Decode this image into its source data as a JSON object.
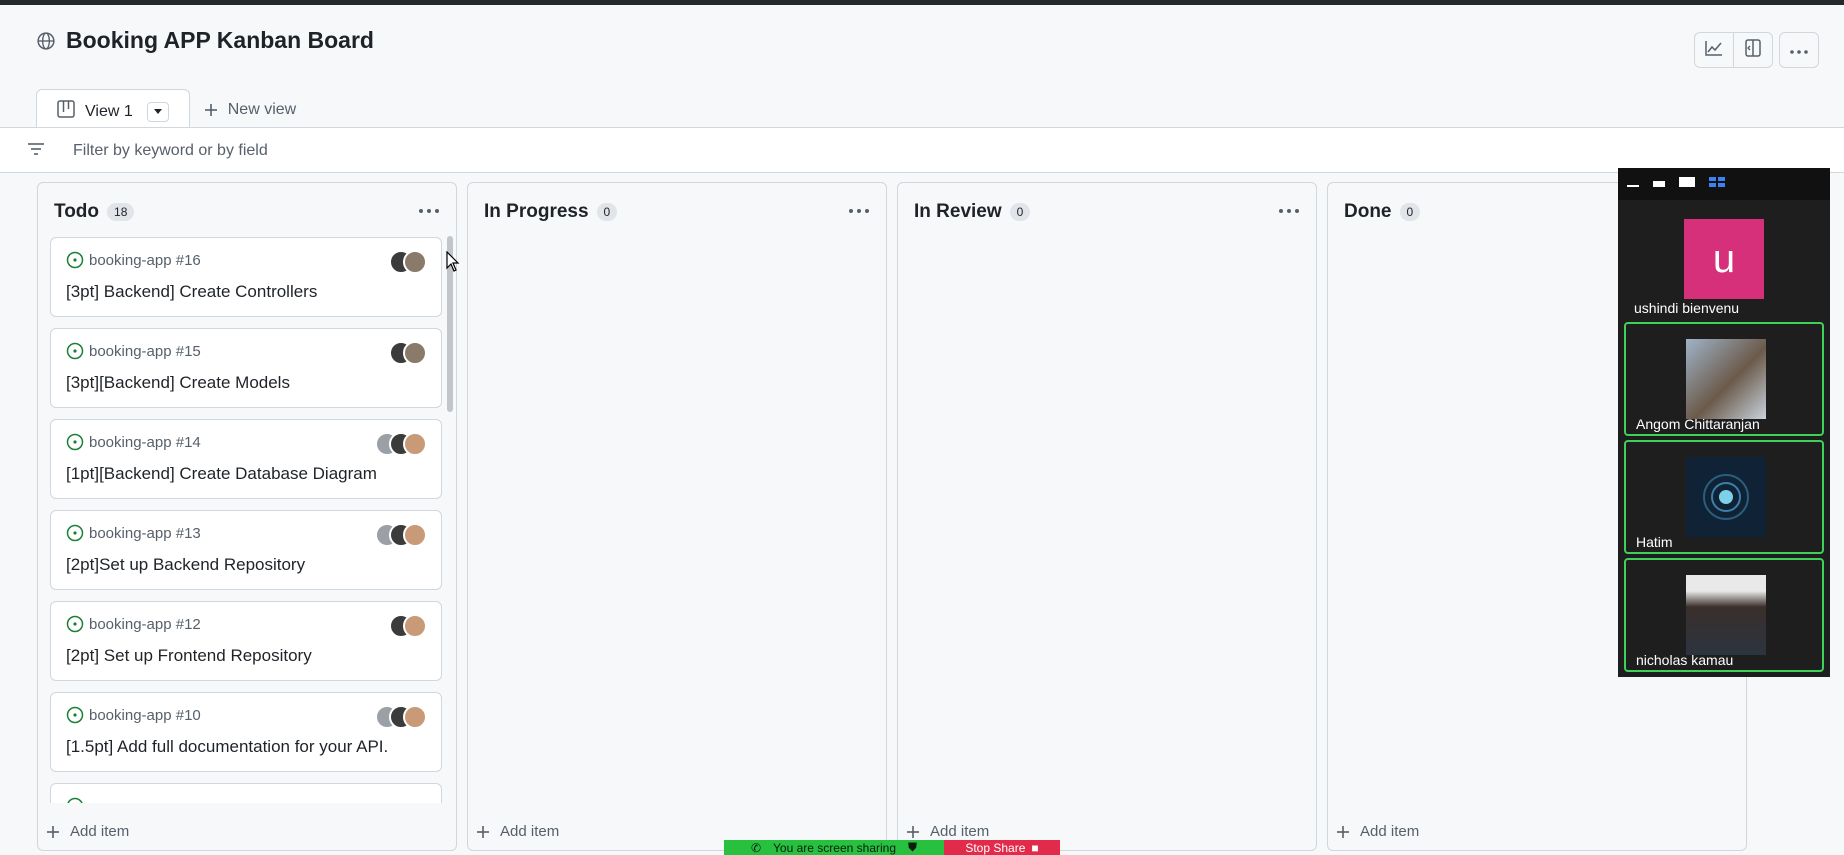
{
  "header": {
    "title": "Booking APP Kanban Board",
    "actions": [
      "insights-icon",
      "panel-icon",
      "more-icon"
    ]
  },
  "tabs": {
    "active_label": "View 1",
    "new_view_label": "New view"
  },
  "filter": {
    "placeholder": "Filter by keyword or by field"
  },
  "columns": [
    {
      "title": "Todo",
      "count": "18",
      "add_label": "Add item",
      "cards": [
        {
          "ref": "booking-app #16",
          "title": "[3pt] Backend] Create Controllers"
        },
        {
          "ref": "booking-app #15",
          "title": "[3pt][Backend] Create Models"
        },
        {
          "ref": "booking-app #14",
          "title": "[1pt][Backend] Create Database Diagram"
        },
        {
          "ref": "booking-app #13",
          "title": "[2pt]Set up Backend Repository"
        },
        {
          "ref": "booking-app #12",
          "title": "[2pt] Set up Frontend Repository"
        },
        {
          "ref": "booking-app #10",
          "title": "[1.5pt] Add full documentation for your API."
        }
      ]
    },
    {
      "title": "In Progress",
      "count": "0",
      "add_label": "Add item"
    },
    {
      "title": "In Review",
      "count": "0",
      "add_label": "Add item"
    },
    {
      "title": "Done",
      "count": "0",
      "add_label": "Add item"
    }
  ],
  "video_panel": {
    "participants": [
      {
        "name": "ushindi bienvenu",
        "initial": "u"
      },
      {
        "name": "Angom Chittaranjan"
      },
      {
        "name": "Hatim"
      },
      {
        "name": "nicholas kamau"
      }
    ]
  },
  "share_bar": {
    "status": "You are screen sharing",
    "stop_label": "Stop Share"
  },
  "colors": {
    "open_issue": "#1a7f37",
    "border": "#d0d7de",
    "active_speaker": "#3fd05a",
    "share_green": "#27c13f",
    "stop_red": "#e22b4b"
  }
}
